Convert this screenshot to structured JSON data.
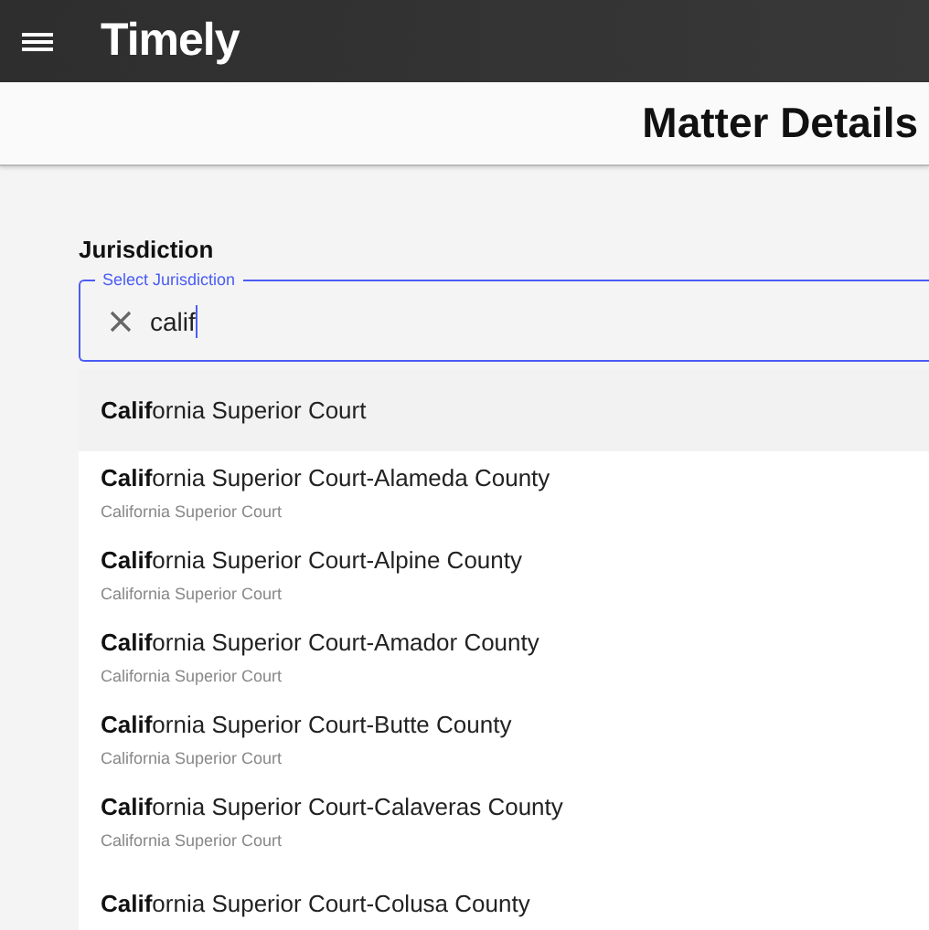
{
  "app_bar": {
    "title": "Timely"
  },
  "page_header": {
    "title": "Matter Details"
  },
  "jurisdiction": {
    "label": "Jurisdiction",
    "field_label": "Select Jurisdiction",
    "value": "calif"
  },
  "options": [
    {
      "title": "**Calif**ornia Superior Court",
      "selected": true
    },
    {
      "title": "**Calif**ornia Superior Court-Alameda County",
      "subtitle": "California Superior Court",
      "selected": false
    },
    {
      "title": "**Calif**ornia Superior Court-Alpine County",
      "subtitle": "California Superior Court",
      "selected": false
    },
    {
      "title": "**Calif**ornia Superior Court-Amador County",
      "subtitle": "California Superior Court",
      "selected": false
    },
    {
      "title": "**Calif**ornia Superior Court-Butte County",
      "subtitle": "California Superior Court",
      "selected": false
    },
    {
      "title": "**Calif**ornia Superior Court-Calaveras County",
      "subtitle": "California Superior Court",
      "selected": false
    },
    {
      "title": "**Calif**ornia Superior Court-Colusa County",
      "selected": false
    }
  ]
}
